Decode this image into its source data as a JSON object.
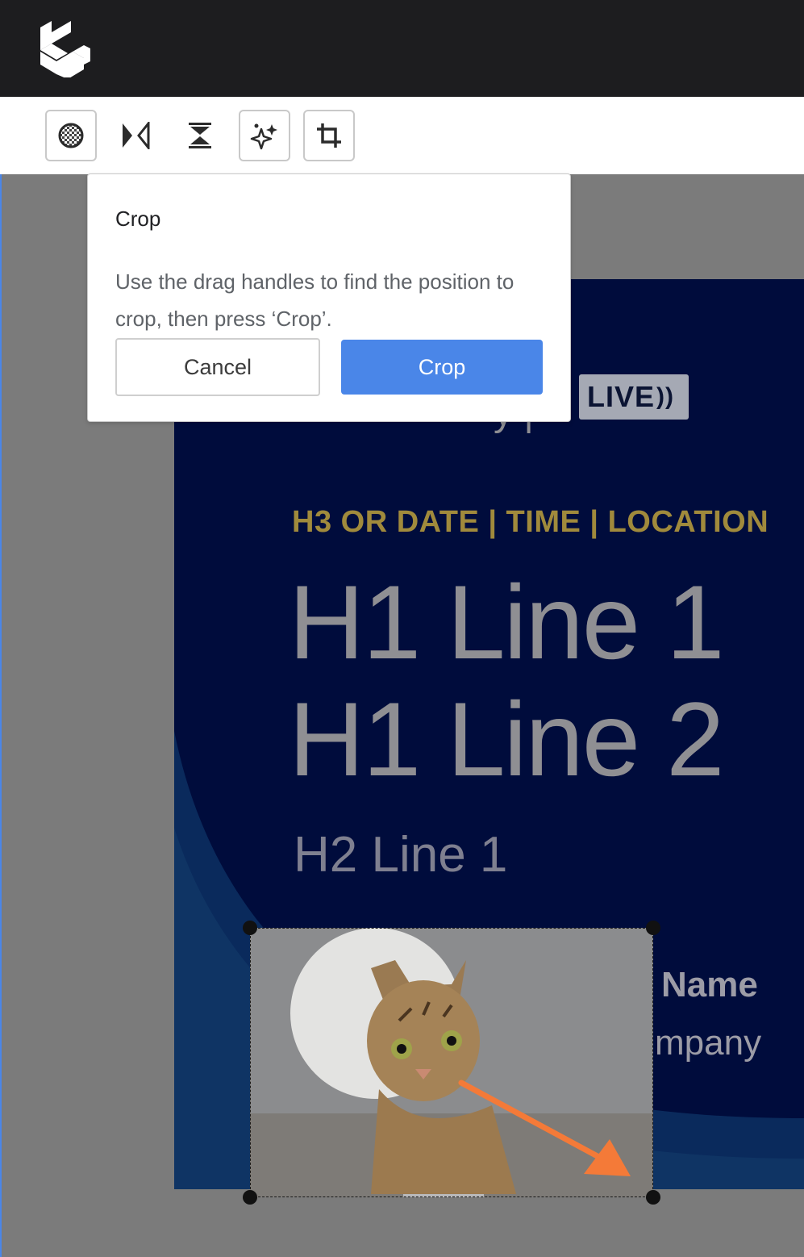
{
  "app": {
    "logo_icon": "app-logo-icon"
  },
  "toolbar": {
    "tools": [
      {
        "name": "transparency-tool",
        "icon": "checker-circle-icon",
        "boxed": true
      },
      {
        "name": "flip-horizontal-tool",
        "icon": "flip-horizontal-icon",
        "boxed": false
      },
      {
        "name": "flip-vertical-tool",
        "icon": "flip-vertical-icon",
        "boxed": false
      },
      {
        "name": "magic-enhance-tool",
        "icon": "sparkles-icon",
        "boxed": true
      },
      {
        "name": "crop-tool",
        "icon": "crop-icon",
        "boxed": true
      }
    ]
  },
  "popover": {
    "title": "Crop",
    "text": "Use the drag handles to find the position to crop, then press ‘Crop’.",
    "cancel_label": "Cancel",
    "confirm_label": "Crop"
  },
  "banner": {
    "live_label": "LIVE",
    "eyebrow": "H3 OR DATE | TIME | LOCATION",
    "h1_line1": "H1 Line 1",
    "h1_line2": "H1 Line 2",
    "h2_line1": "H2 Line 1",
    "speaker_name": "Name",
    "speaker_company": "mpany",
    "colors": {
      "background": "#000c3c",
      "eyebrow": "#a08a3c",
      "accent_arrow": "#f47a38",
      "primary_button": "#4a86e8"
    }
  },
  "crop": {
    "image_subject": "cat-photo"
  }
}
